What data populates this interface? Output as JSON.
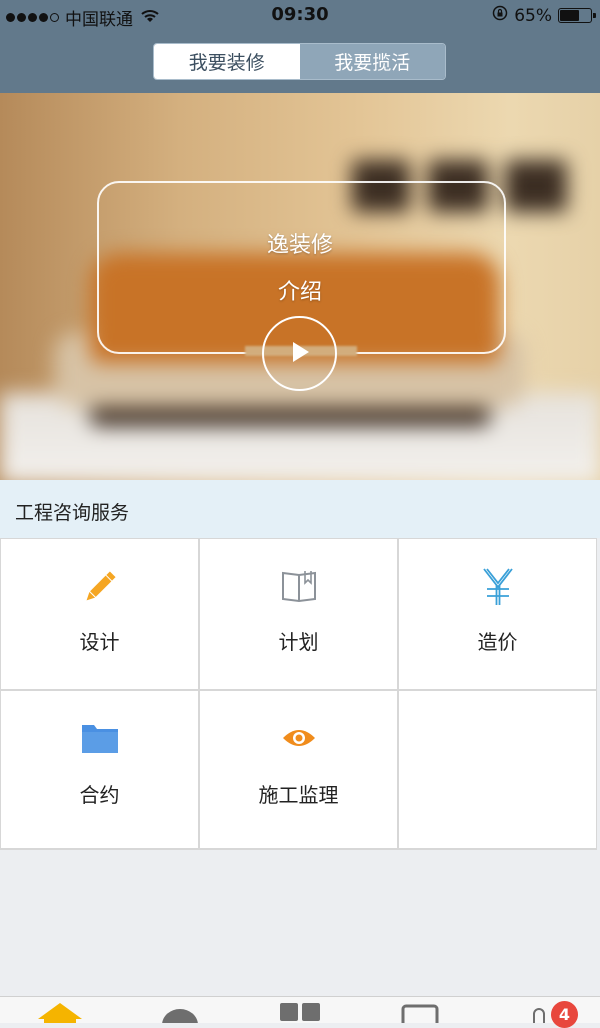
{
  "status_bar": {
    "carrier": "中国联通",
    "time": "09:30",
    "battery": "65%",
    "battery_level": 0.65,
    "icons": [
      "signal-dots-icon",
      "wifi-icon",
      "rotation-lock-icon",
      "battery-icon"
    ]
  },
  "segment": {
    "items": [
      {
        "label": "我要装修",
        "active": true
      },
      {
        "label": "我要揽活",
        "active": false
      }
    ]
  },
  "hero": {
    "title": "逸装修",
    "subtitle": "介绍",
    "icon": "play-icon"
  },
  "section": {
    "title": "工程咨询服务"
  },
  "services": [
    {
      "label": "设计",
      "icon": "pencil-icon",
      "color": "#f5a623"
    },
    {
      "label": "计划",
      "icon": "book-icon",
      "color": "#8c9299"
    },
    {
      "label": "造价",
      "icon": "yen-icon",
      "color": "#3aa0d8"
    },
    {
      "label": "合约",
      "icon": "folder-icon",
      "color": "#4a90e2"
    },
    {
      "label": "施工监理",
      "icon": "eye-icon",
      "color": "#f08c1c"
    }
  ],
  "tabbar": {
    "icons": [
      "home-icon",
      "chat-icon",
      "grid-icon",
      "tablet-icon",
      "user-icon"
    ],
    "badge": "4",
    "active_color": "#f5b400"
  },
  "colors": {
    "header": "#62798b",
    "segment_inactive": "#8fa6b8",
    "section_header": "#e4f0f7",
    "page_background": "#eceef1",
    "badge": "#e8473d"
  }
}
